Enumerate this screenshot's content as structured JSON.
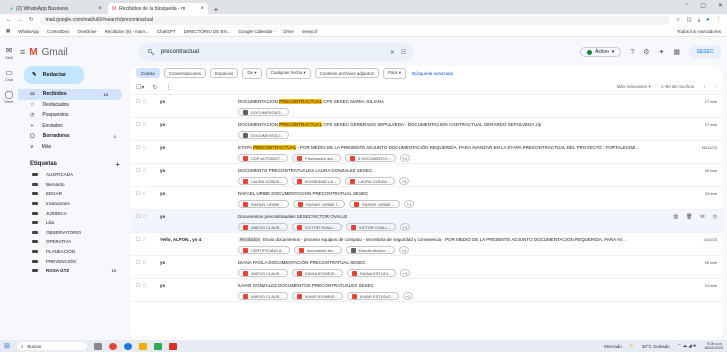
{
  "browser": {
    "tabs": [
      {
        "label": "(2) WhatsApp Business"
      },
      {
        "label": "Recibidos de la búsqueda - m"
      }
    ],
    "new_tab": "+",
    "url": "mail.google.com/mail/u/0/#search/precontractual",
    "bookmarks": [
      "WhatsApp",
      "ControlDoc",
      "OneDrive",
      "Recibidos (8) - mam...",
      "ChatGPT",
      "DIRECTORIO DE EN...",
      "Google Calendar -",
      "Drive",
      "sesep.tl"
    ],
    "bookmarks_right": "Todos los marcadores"
  },
  "rail": [
    {
      "glyph": "✉",
      "label": "Mail"
    },
    {
      "glyph": "▭",
      "label": "Chat"
    },
    {
      "glyph": "◯",
      "label": "Meet"
    }
  ],
  "app": {
    "name": "Gmail",
    "search_query": "precontractual",
    "status": "Activo",
    "brand": "SESEC"
  },
  "compose_label": "Redactar",
  "nav": [
    {
      "icon": "▭",
      "label": "Recibidos",
      "count": "10"
    },
    {
      "icon": "☆",
      "label": "Destacados",
      "count": ""
    },
    {
      "icon": "◷",
      "label": "Pospuestos",
      "count": ""
    },
    {
      "icon": "➢",
      "label": "Enviados",
      "count": ""
    },
    {
      "icon": "▢",
      "label": "Borradores",
      "count": "1"
    },
    {
      "icon": "∨",
      "label": "Más",
      "count": ""
    }
  ],
  "labels_title": "Etiquetas",
  "labels": [
    {
      "label": "AUXIFICADA",
      "count": ""
    },
    {
      "label": "Bernardo",
      "count": ""
    },
    {
      "label": "EDGAR",
      "count": ""
    },
    {
      "label": "Invitaciones",
      "count": ""
    },
    {
      "label": "JURIDICA",
      "count": ""
    },
    {
      "label": "Lilia",
      "count": ""
    },
    {
      "label": "OBSERVATORIO",
      "count": ""
    },
    {
      "label": "OPERATIVA",
      "count": ""
    },
    {
      "label": "PLANEACIÓN",
      "count": ""
    },
    {
      "label": "PREVENCIÓN",
      "count": ""
    },
    {
      "label": "ROSA GTZ",
      "count": "15"
    }
  ],
  "filters": [
    "Correo",
    "Conversaciones",
    "Espacios",
    "De",
    "Cualquier fecha",
    "Contiene archivos adjuntos",
    "Para"
  ],
  "advanced_search": "Búsqueda avanzada",
  "sort_label": "Más relevantes",
  "pagination": "1–50 de muchos",
  "rows": [
    {
      "sender": "yo",
      "subject_pre": "DOCUMENTACION ",
      "subject_hl": "PRECONTRACTUAL",
      "subject_post": " CPS SESEC MARIA JULIANA",
      "date": "17 ene",
      "attachments": [
        {
          "name": "DOCUMENTACI...",
          "color": "#5f6368"
        }
      ],
      "more": ""
    },
    {
      "sender": "yo",
      "subject_pre": "DOCUMENTACION ",
      "subject_hl": "PRECONTRACTUAL",
      "subject_post": " CPS SESEC GERERADO SEPULVEDA - DOCUMENTACION CONTRACTUAL GERARDO SEPULVEDA.zip",
      "date": "17 ene",
      "attachments": [
        {
          "name": "DOCUMENTACI...",
          "color": "#5f6368"
        }
      ],
      "more": ""
    },
    {
      "sender": "yo",
      "subject_pre": "ETAPA ",
      "subject_hl": "PRECONTRACTUAL",
      "subject_post": " - POR MEDIO DE LA PRESENTE ADJUNTO DOCUMENTACIÓN REQUERIDA, PARA AVANZAR EN LA ETAPA PRECONTRACTUAL DEL PROYECTO : FORTALECIMI...",
      "date": "26/11/23",
      "attachments": [
        {
          "name": "CDP AUTOMOT...",
          "color": "#ea4335"
        },
        {
          "name": "Priorización aut...",
          "color": "#ea4335"
        },
        {
          "name": "3 DOCUMENTO...",
          "color": "#ea4335"
        }
      ],
      "more": "+1"
    },
    {
      "sender": "yo",
      "subject_pre": "DOCUMENTO PRECONTRATUALES LAURA GONZALEZ SESEC",
      "subject_hl": "",
      "subject_post": "",
      "date": "26 ene",
      "attachments": [
        {
          "name": "LAURA GONZA...",
          "color": "#ea4335"
        },
        {
          "name": "IDONEIDAD LA...",
          "color": "#ea4335"
        },
        {
          "name": "LAURA GONZA...",
          "color": "#ea4335"
        }
      ],
      "more": "+1"
    },
    {
      "sender": "yo",
      "subject_pre": "RAFAEL URIBE DOCUMENTACIÓN PRECONTRATUAL SESEC",
      "subject_hl": "",
      "subject_post": "",
      "date": "23 ene",
      "attachments": [
        {
          "name": "RAFAEL URIBE ...",
          "color": "#ea4335"
        },
        {
          "name": "RAFAEL URIBE I...",
          "color": "#ea4335"
        },
        {
          "name": "RAFAEL URIBE ...",
          "color": "#ea4335"
        }
      ],
      "more": "+1"
    },
    {
      "sender": "yo",
      "subject_pre": "Documentos precontratuales SESECVICTOR OVALLE",
      "subject_hl": "",
      "subject_post": "",
      "date": "",
      "attachments": [
        {
          "name": "ANEXO CLAUS...",
          "color": "#ea4335"
        },
        {
          "name": "VICTOR OVALL...",
          "color": "#ea4335"
        },
        {
          "name": "VICTOR OVALL...",
          "color": "#ea4335"
        }
      ],
      "more": "+1",
      "hover": true
    },
    {
      "sender": "Yello, ALFON., yo 4",
      "badge": "Recibidos",
      "subject_pre": "Envio documentos - proceso equipos de computo - secretaria de seguridad y convivencia - POR MEDIO DE LA PRESENTE ADJUNTO DOCUMENTACION REQUERIDA, PARA AV...",
      "subject_hl": "",
      "subject_post": "",
      "date": "4/12/23",
      "attachments": [
        {
          "name": "CERTIFICADO A...",
          "color": "#ea4335"
        },
        {
          "name": "documento tec...",
          "color": "#ea4335"
        },
        {
          "name": "Estudio técnico ...",
          "color": "#5f6368"
        }
      ],
      "more": "+1"
    },
    {
      "sender": "yo",
      "subject_pre": "DIANA PAOLA DOCUMENTACIÓN PRECONTRATUAL SESEC",
      "subject_hl": "",
      "subject_post": "",
      "date": "26 ene",
      "attachments": [
        {
          "name": "ANEXO CLAUS...",
          "color": "#ea4335"
        },
        {
          "name": "DIANA IDONEID...",
          "color": "#ea4335"
        },
        {
          "name": "DIANA ESTUDI...",
          "color": "#ea4335"
        }
      ],
      "more": "+1"
    },
    {
      "sender": "yo",
      "subject_pre": "IUVAR GONZALEZ DOCUMENTOS PRECONTRATUALES SESEC",
      "subject_hl": "",
      "subject_post": "",
      "date": "21 ene",
      "attachments": [
        {
          "name": "ANEXO CLAUS...",
          "color": "#ea4335"
        },
        {
          "name": "IUVAR IDONEID...",
          "color": "#ea4335"
        },
        {
          "name": "IUVAR ESTUDIO...",
          "color": "#ea4335"
        }
      ],
      "more": "+1"
    }
  ],
  "taskbar": {
    "search": "Buscar",
    "weather": "30°C Soleado",
    "time": "9:00 a.m.",
    "date": "16/02/2024",
    "location": "Mercado"
  }
}
